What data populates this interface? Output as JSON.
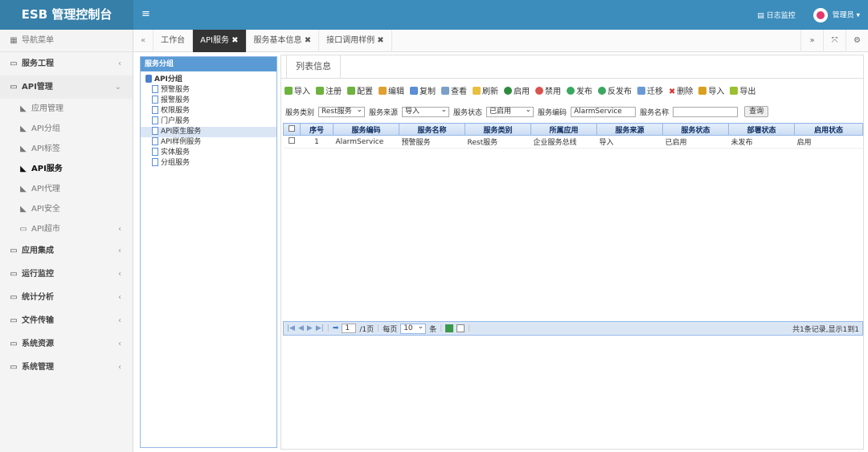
{
  "app": {
    "title": "ESB 管理控制台",
    "log_monitor": "日志监控",
    "user": "管理员"
  },
  "sidebar": {
    "header": "导航菜单",
    "items": [
      {
        "label": "服务工程"
      },
      {
        "label": "API管理"
      },
      {
        "label": "应用集成"
      },
      {
        "label": "运行监控"
      },
      {
        "label": "统计分析"
      },
      {
        "label": "文件传输"
      },
      {
        "label": "系统资源"
      },
      {
        "label": "系统管理"
      }
    ],
    "api_sub": [
      {
        "label": "应用管理"
      },
      {
        "label": "API分组"
      },
      {
        "label": "API标签"
      },
      {
        "label": "API服务"
      },
      {
        "label": "API代理"
      },
      {
        "label": "API安全"
      },
      {
        "label": "API超市"
      }
    ]
  },
  "tabs": [
    {
      "label": "工作台"
    },
    {
      "label": "API服务 ✖"
    },
    {
      "label": "服务基本信息 ✖"
    },
    {
      "label": "接口调用样例 ✖"
    }
  ],
  "tree": {
    "title": "服务分组",
    "root": "API分组",
    "nodes": [
      "预警服务",
      "报警服务",
      "权限服务",
      "门户服务",
      "API原生服务",
      "API样例服务",
      "实体服务",
      "分组服务"
    ]
  },
  "main": {
    "tab": "列表信息",
    "toolbar": [
      "导入",
      "注册",
      "配置",
      "编辑",
      "复制",
      "查看",
      "刷新",
      "启用",
      "禁用",
      "发布",
      "反发布",
      "迁移",
      "删除",
      "导入",
      "导出"
    ],
    "filter": {
      "type_label": "服务类别",
      "type_value": "Rest服务",
      "source_label": "服务来源",
      "source_value": "导入",
      "status_label": "服务状态",
      "status_value": "已启用",
      "code_label": "服务编码",
      "code_value": "AlarmService",
      "name_label": "服务名称",
      "name_value": "",
      "query_button": "查询"
    },
    "columns": [
      "序号",
      "服务编码",
      "服务名称",
      "服务类别",
      "所属应用",
      "服务来源",
      "服务状态",
      "部署状态",
      "启用状态"
    ],
    "rows": [
      [
        "1",
        "AlarmService",
        "预警服务",
        "Rest服务",
        "企业服务总线",
        "导入",
        "已启用",
        "未发布",
        "启用"
      ]
    ],
    "pager": {
      "page": "1",
      "total_pages": "/1页",
      "per_page_label": "每页",
      "per_page": "10",
      "unit": "条",
      "summary": "共1条记录,显示1到1"
    }
  },
  "colors": {
    "topbar": "#3c8dbc",
    "grid_header": "#cbdcf3",
    "tree_header": "#5b9bd5"
  }
}
